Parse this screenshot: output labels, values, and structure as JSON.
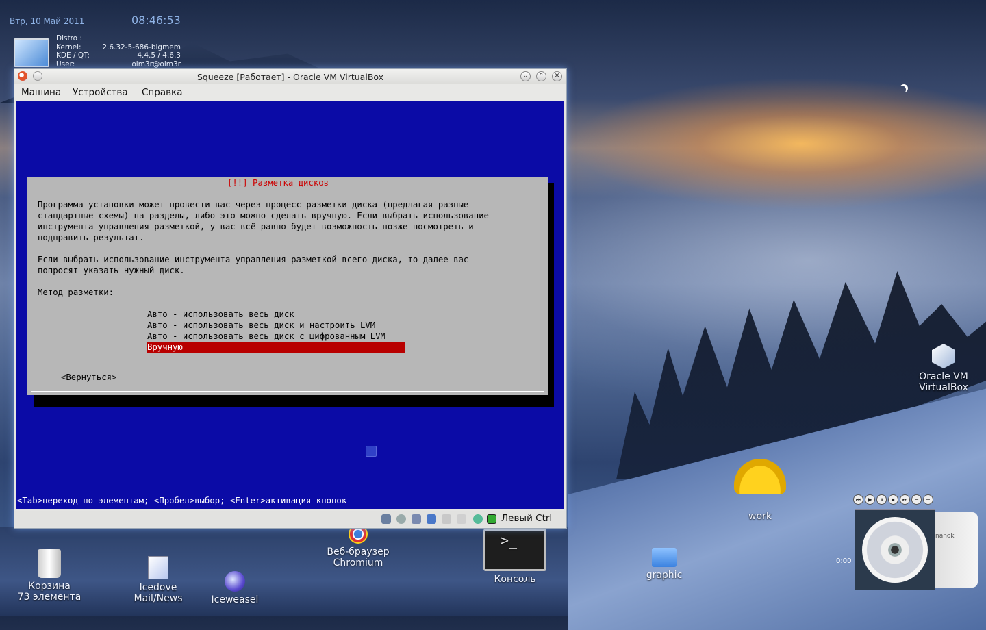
{
  "desktop": {
    "clock": {
      "date": "Втр, 10 Май 2011",
      "time": "08:46:53"
    },
    "sysinfo": [
      {
        "label": "Distro :",
        "value": ""
      },
      {
        "label": "Kernel:",
        "value": "2.6.32-5-686-bigmem"
      },
      {
        "label": "KDE / QT:",
        "value": "4.4.5 / 4.6.3"
      },
      {
        "label": "User:",
        "value": "olm3r@olm3r"
      }
    ],
    "icons": {
      "trash": {
        "line1": "Корзина",
        "line2": "73 элемента"
      },
      "mail": {
        "line1": "Icedove",
        "line2": "Mail/News"
      },
      "iceweasel": {
        "line1": "Iceweasel"
      },
      "chromium": {
        "line1": "Веб-браузер",
        "line2": "Chromium"
      },
      "console": {
        "line1": "Консоль",
        "glyph": ">_"
      },
      "graphic": {
        "line1": "graphic"
      },
      "work": {
        "line1": "work"
      },
      "virtualbox": {
        "line1": "Oracle VM",
        "line2": "VirtualBox"
      }
    },
    "player": {
      "time": "0:00",
      "buttons": [
        "⏮",
        "▶",
        "⏸",
        "⏹",
        "⏭",
        "−",
        "+"
      ],
      "album_text": "nanok"
    }
  },
  "window": {
    "title": "Squeeze [Работает] - Oracle VM VirtualBox",
    "menu": [
      "Машина",
      "Устройства",
      "Справка"
    ],
    "controls": {
      "minimize": "⌄",
      "maximize": "⌃",
      "close": "✕"
    },
    "host_key": "Левый Ctrl"
  },
  "installer": {
    "dialog_title": "[!!] Разметка дисков",
    "paragraph1": [
      "Программа установки может провести вас через процесс разметки диска (предлагая разные",
      "стандартные схемы) на разделы, либо это можно сделать вручную. Если выбрать использование",
      "инструмента управления разметкой, у вас всё равно будет возможность позже посмотреть и",
      "подправить результат."
    ],
    "paragraph2": [
      "Если выбрать использование инструмента управления разметкой всего диска, то далее вас",
      "попросят указать нужный диск."
    ],
    "method_label": "Метод разметки:",
    "options": [
      "Авто - использовать весь диск",
      "Авто - использовать весь диск и настроить LVM",
      "Авто - использовать весь диск с шифрованным LVM",
      "Вручную"
    ],
    "selected_option": "Вручную",
    "back_button": "<Вернуться>",
    "hint": "<Tab>переход по элементам; <Пробел>выбор; <Enter>активация кнопок"
  },
  "colors": {
    "console_bg": "#0b0ba6",
    "dialog_bg": "#b7b7b7",
    "selection": "#b80000",
    "title_red": "#cc0000"
  }
}
